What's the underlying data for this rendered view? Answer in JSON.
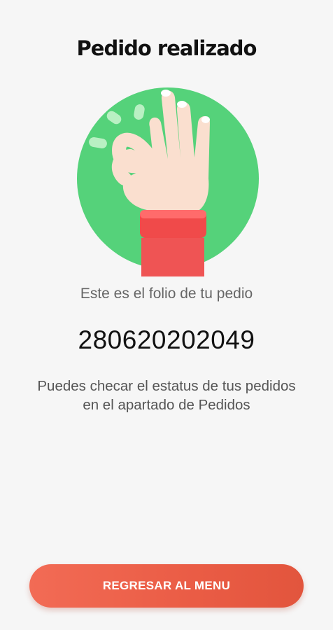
{
  "header": {
    "title": "Pedido realizado"
  },
  "illustration": {
    "icon": "ok-hand-icon",
    "circle_color": "#55d27a",
    "sleeve_color": "#f04a4a",
    "skin_color": "#fadfcf"
  },
  "folio": {
    "label": "Este es el folio de tu pedio",
    "number": "280620202049"
  },
  "info": {
    "line1": "Puedes checar el estatus de tus pedidos",
    "line2": "en el apartado de Pedidos"
  },
  "actions": {
    "back_label": "REGRESAR AL MENU",
    "accent": "#ec604a"
  }
}
